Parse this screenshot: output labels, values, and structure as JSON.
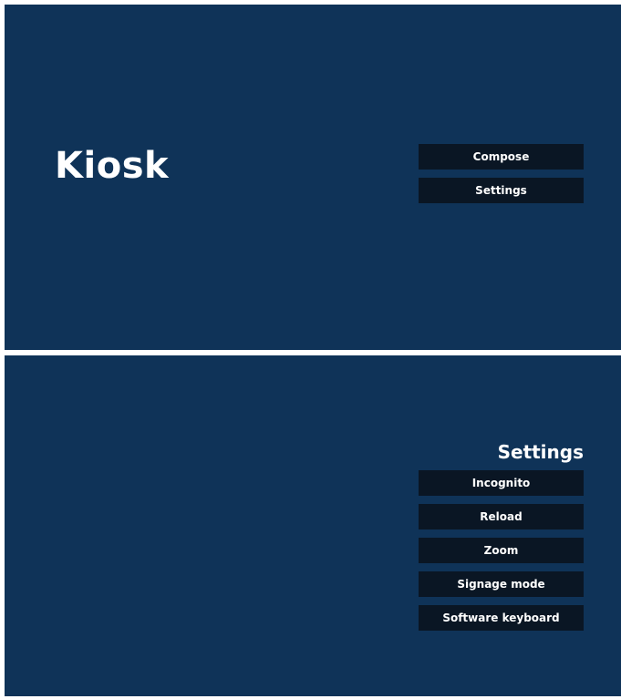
{
  "main_screen": {
    "title": "Kiosk",
    "menu": [
      {
        "label": "Compose"
      },
      {
        "label": "Settings"
      }
    ]
  },
  "settings_screen": {
    "heading": "Settings",
    "menu": [
      {
        "label": "Incognito"
      },
      {
        "label": "Reload"
      },
      {
        "label": "Zoom"
      },
      {
        "label": "Signage mode"
      },
      {
        "label": "Software keyboard"
      }
    ]
  },
  "colors": {
    "background": "#0f3358",
    "button": "#0a1624",
    "text": "#ffffff",
    "separator": "#ffffff"
  }
}
